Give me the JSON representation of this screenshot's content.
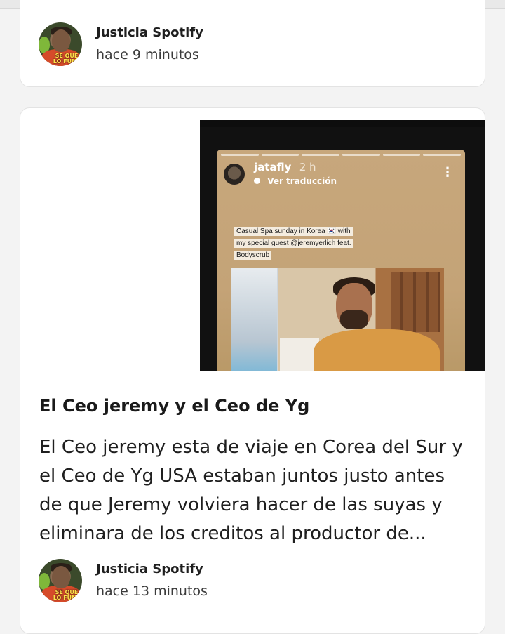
{
  "posts": [
    {
      "author": "Justicia Spotify",
      "time": "hace 9 minutos",
      "avatar_text": "SE QUE LO FUNE"
    },
    {
      "media": {
        "story_username": "jatafly",
        "story_age": "2 h",
        "story_translate": "Ver traducción",
        "story_caption": "Casual Spa sunday in Korea 🇰🇷 with my special guest @jeremyerlich feat. Bodyscrub"
      },
      "headline": "El Ceo jeremy y el Ceo de Yg",
      "summary": "El Ceo jeremy esta de viaje en Corea del Sur y el Ceo de Yg USA estaban juntos justo antes de que Jeremy volviera hacer de las suyas y eliminara de los creditos  al productor de...",
      "author": "Justicia Spotify",
      "time": "hace 13 minutos",
      "avatar_text": "SE QUE LO FUNE"
    }
  ]
}
